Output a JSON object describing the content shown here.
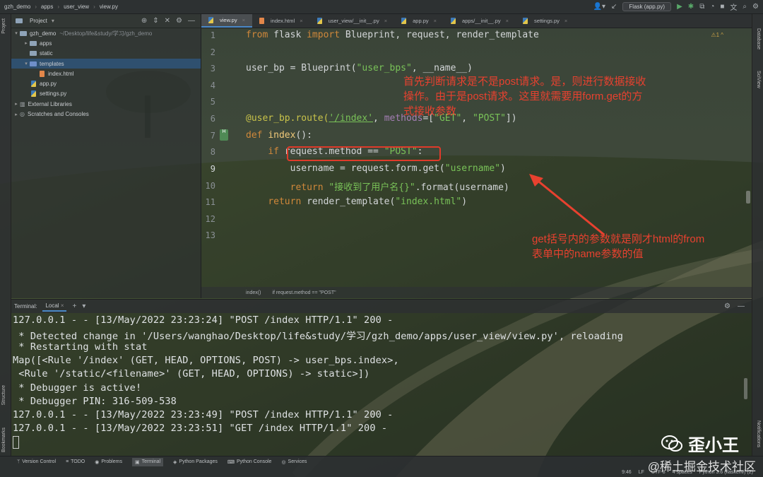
{
  "breadcrumb": [
    "gzh_demo",
    "apps",
    "user_view",
    "view.py"
  ],
  "run_config": "Flask (app.py)",
  "left_tabs": [
    "Project",
    "Structure",
    "Bookmarks"
  ],
  "right_tabs": [
    "Database",
    "SciView",
    "Notifications"
  ],
  "project": {
    "title": "Project",
    "tree": [
      {
        "label": "gzh_demo",
        "extra": "~/Desktop/life&study/学习/gzh_demo",
        "type": "folder",
        "depth": 0,
        "open": true
      },
      {
        "label": "apps",
        "type": "folder",
        "depth": 1,
        "open": false
      },
      {
        "label": "static",
        "type": "folder",
        "depth": 1,
        "open": null
      },
      {
        "label": "templates",
        "type": "folder-blue",
        "depth": 1,
        "open": true,
        "selected": true
      },
      {
        "label": "index.html",
        "type": "html",
        "depth": 2
      },
      {
        "label": "app.py",
        "type": "py",
        "depth": 1
      },
      {
        "label": "settings.py",
        "type": "py",
        "depth": 1
      },
      {
        "label": "External Libraries",
        "type": "lib",
        "depth": 0,
        "open": false
      },
      {
        "label": "Scratches and Consoles",
        "type": "scratch",
        "depth": 0,
        "open": false
      }
    ]
  },
  "tabs": [
    {
      "label": "view.py",
      "active": true
    },
    {
      "label": "index.html"
    },
    {
      "label": "user_view/__init__.py"
    },
    {
      "label": "app.py"
    },
    {
      "label": "apps/__init__.py"
    },
    {
      "label": "settings.py"
    }
  ],
  "editor": {
    "warning": "⚠1 ^",
    "line_numbers": [
      "1",
      "2",
      "3",
      "4",
      "5",
      "6",
      "7",
      "8",
      "9",
      "10",
      "11",
      "12",
      "13"
    ],
    "code": {
      "l1": [
        "from",
        " flask ",
        "import",
        " Blueprint, request, render_template"
      ],
      "l3": [
        "user_bp = Blueprint(",
        "\"user_bps\"",
        ", ",
        "__name__",
        ")"
      ],
      "l6": [
        "@user_bp.route(",
        "'/index'",
        ", ",
        "methods",
        "=[",
        "\"GET\"",
        ", ",
        "\"POST\"",
        "])"
      ],
      "l7": [
        "def",
        " ",
        "index",
        "():"
      ],
      "l8": [
        "    ",
        "if",
        " request.method == ",
        "\"POST\"",
        ":"
      ],
      "l9": [
        "        username = request.form.get(",
        "\"username\"",
        ")"
      ],
      "l10": [
        "        ",
        "return",
        " ",
        "\"接收到了用户名{}\"",
        ".format(username)"
      ],
      "l11": [
        "    ",
        "return",
        " render_template(",
        "\"index.html\"",
        ")"
      ]
    },
    "annotation_top": [
      "首先判断请求是不是post请求。是，则进行数据接收",
      "操作。由于是post请求。这里就需要用form.get的方",
      "式接收参数"
    ],
    "annotation_bottom": [
      "get括号内的参数就是刚才html的from",
      "表单中的name参数的值"
    ],
    "breadcrumb": [
      "index()",
      "if request.method == \"POST\""
    ]
  },
  "terminal": {
    "label": "Terminal:",
    "tab": "Local",
    "lines": [
      "127.0.0.1 - - [13/May/2022 23:23:24] \"POST /index HTTP/1.1\" 200 -",
      " * Detected change in '/Users/wanghao/Desktop/life&study/学习/gzh_demo/apps/user_view/view.py', reloading",
      " * Restarting with stat",
      "Map([<Rule '/index' (GET, HEAD, OPTIONS, POST) -> user_bps.index>,",
      " <Rule '/static/<filename>' (GET, HEAD, OPTIONS) -> static>])",
      " * Debugger is active!",
      " * Debugger PIN: 316-509-538",
      "127.0.0.1 - - [13/May/2022 23:23:49] \"POST /index HTTP/1.1\" 200 -",
      "127.0.0.1 - - [13/May/2022 23:23:51] \"GET /index HTTP/1.1\" 200 -"
    ]
  },
  "bottom_tools": [
    "Version Control",
    "TODO",
    "Problems",
    "Terminal",
    "Python Packages",
    "Python Console",
    "Services"
  ],
  "status": [
    "9:46",
    "LF",
    "UTF-8",
    "4 spaces",
    "Python 3.6 (flaskenv) (2)"
  ],
  "watermark": {
    "name": "歪小王",
    "sub": "@稀土掘金技术社区"
  }
}
